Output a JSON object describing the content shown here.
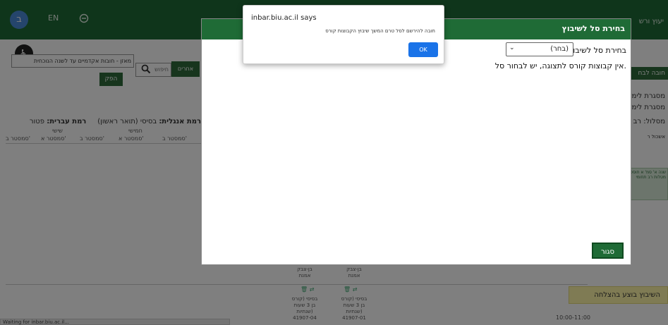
{
  "header": {
    "avatar_initial": "ב",
    "lang": "EN",
    "right_text": "יעוץ ורש"
  },
  "toolbar": {
    "year_select": "מאזן - חובות אקדמיים עד לשנה הנוכחית",
    "search_placeholder": "חיפוש",
    "others_label": "אחרים",
    "run_label": "הפק"
  },
  "side": {
    "right_button": "חובה לבח",
    "right_lines": [
      "מסגרת לימ",
      "מסגרת לימו",
      "מסלול: רב",
      "אשכול ר"
    ],
    "green_box": "שנה א' סמ' א תוספת מטלות רב תחומי"
  },
  "level": {
    "english_label": "רמת אנגלית:",
    "english_value": "בסיסי (תואר ראשון)",
    "hebrew_label": "רמת עברית:",
    "hebrew_value": "פטור"
  },
  "schedule": {
    "days": [
      "שישי",
      "חמישי"
    ],
    "semesters": [
      "סמסטר ב'",
      "סמסטר א'",
      "סמסטר ב'",
      "סמסטר א'",
      "סמסטר ב'"
    ],
    "time": "10:00-11:00",
    "cells": [
      {
        "a": "בן-צבק",
        "b": "אמנת"
      },
      {
        "a": "בן-צבק",
        "b": "אמנת"
      },
      {
        "a": "בסיסי (קורס",
        "b": "בן 3 שעות",
        "c": "שנתיות)",
        "d": "41907-04"
      },
      {
        "a": "בסיסי (קורס",
        "b": "בן 3 שעות",
        "c": "שנתיות)",
        "d": "41907-01"
      }
    ]
  },
  "toast": "השיבוץ בוצע בהצלחה",
  "status_bar": "Waiting for inbar.biu.ac.il...",
  "modal": {
    "title": "בחירת סל לשיבוץ",
    "select_label": "בחירת סל לשיבוץ",
    "select_value": "(בחר)",
    "note": "אין קבוצות קורס לתצוגה, יש לבחור סל.",
    "close_label": "סגור"
  },
  "alert": {
    "title": "inbar.biu.ac.il says",
    "message": "חובה להירשם לסל טרם המשך שיבוץ הקבוצות קורס",
    "ok_label": "OK"
  },
  "colors": {
    "brand_green": "#1f6b36",
    "alert_blue": "#1a73e8",
    "toast_yellow": "#fef7a8"
  }
}
